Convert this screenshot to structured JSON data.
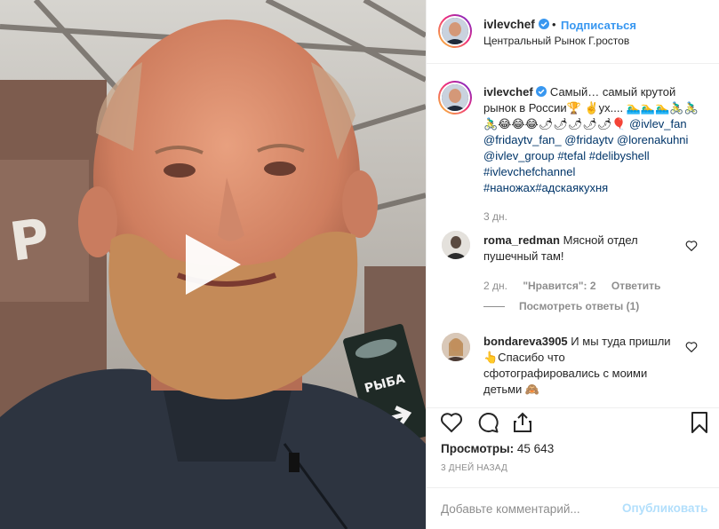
{
  "post": {
    "username": "ivlevchef",
    "follow_label": "Подписаться",
    "separator": "•",
    "location": "Центральный Рынок Г.ростов"
  },
  "caption": {
    "username": "ivlevchef",
    "text": "Самый… самый крутой рынок в России🏆 ✌️ух.... 🏊‍♂️🏊‍♂️🏊‍♂️🚴‍♂️🚴‍♂️🚴‍♂️😂😂😂🌶🌶🌶🌶🌶🎈",
    "mentions": [
      "@ivlev_fan",
      "@fridaytv_fan_",
      "@fridaytv",
      "@lorenakuhni",
      "@ivlev_group",
      "#tefal",
      "#delibyshell",
      "#ivlevchefchannel",
      "#наножах#адскаякухня"
    ],
    "time": "3 дн."
  },
  "comments": [
    {
      "username": "roma_redman",
      "text": "Мясной отдел пушечный там!",
      "time": "2 дн.",
      "likes": "\"Нравится\": 2",
      "reply_label": "Ответить",
      "view_replies": "Посмотреть ответы (1)"
    },
    {
      "username": "bondareva3905",
      "text": "И мы туда пришли 👆Спасибо что сфотографировались с моими детьми 🙈"
    }
  ],
  "stats": {
    "views_label": "Просмотры:",
    "views_value": "45 643",
    "posted": "3 дней назад"
  },
  "composer": {
    "placeholder": "Добавьте комментарий...",
    "publish_label": "Опубликовать"
  },
  "colors": {
    "link": "#3897f0",
    "tag": "#003569",
    "muted": "#8e8e8e",
    "publish_disabled": "#b2dffc"
  },
  "icons": [
    "play-icon",
    "verified-icon",
    "heart-icon",
    "comment-icon",
    "share-icon",
    "bookmark-icon"
  ]
}
